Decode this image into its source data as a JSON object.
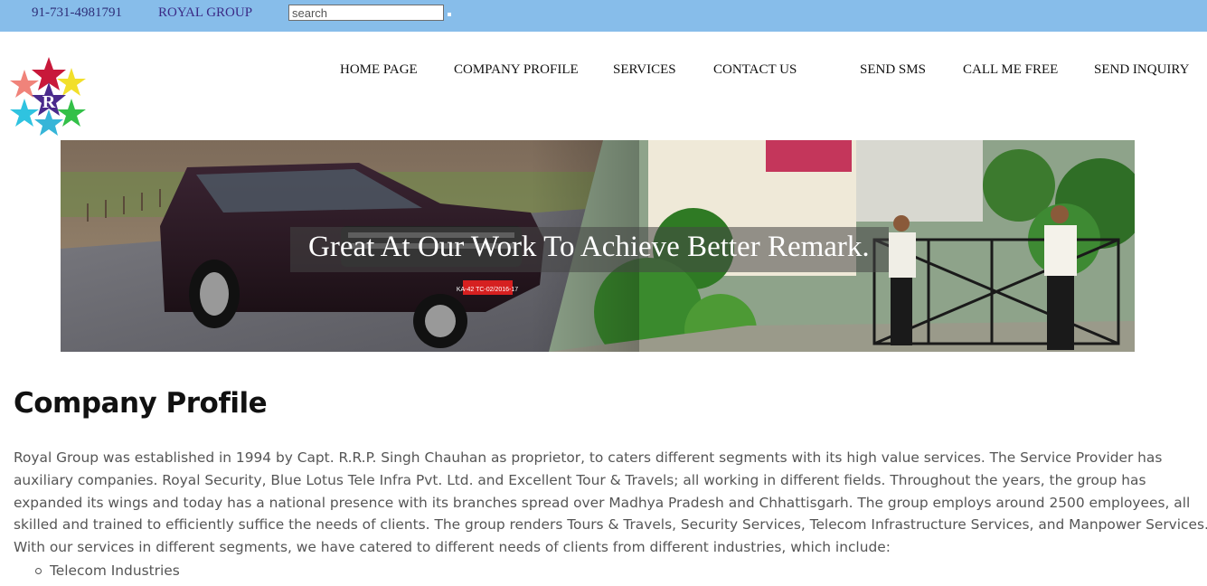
{
  "topbar": {
    "phone": "91-731-4981791",
    "brand": "ROYAL GROUP",
    "search_placeholder": "search",
    "background": "#87bdea"
  },
  "logo": {
    "letter": "R",
    "icon": "star-cluster-logo-icon"
  },
  "nav": [
    "HOME PAGE",
    "COMPANY PROFILE",
    "SERVICES",
    "CONTACT US",
    "SEND SMS",
    "CALL ME FREE",
    "SEND INQUIRY"
  ],
  "hero": {
    "caption": "Great At Our Work To Achieve Better Remark.",
    "plate": "KA-42 TC-02/2016-17"
  },
  "content": {
    "title": "Company Profile",
    "paragraph": "Royal Group was established in 1994 by Capt. R.R.P. Singh Chauhan as proprietor, to caters different segments with its high value services. The Service Provider has auxiliary companies. Royal Security, Blue Lotus Tele Infra Pvt. Ltd. and Excellent Tour & Travels; all working in different fields. Throughout the years, the group has expanded its wings and today has a national presence with its branches spread over Madhya Pradesh and Chhattisgarh. The group employs around 2500 employees, all skilled and trained to efficiently suffice the needs of clients. The group renders Tours & Travels, Security Services, Telecom Infrastructure Services, and Manpower Services. With our services in different segments, we have catered to different needs of clients from different industries, which include:",
    "industries": [
      "Telecom Industries"
    ]
  }
}
